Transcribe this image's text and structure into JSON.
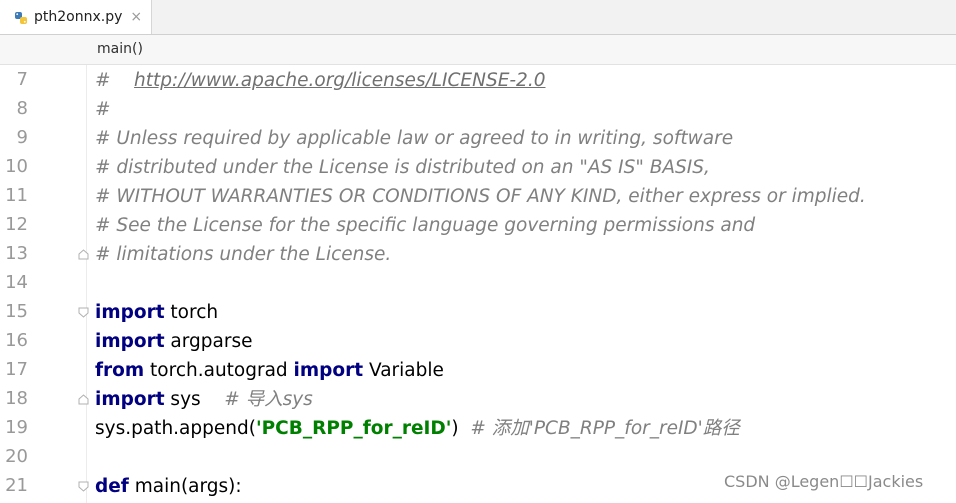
{
  "tab": {
    "filename": "pth2onnx.py",
    "close": "×",
    "icon": "python-file-icon"
  },
  "breadcrumb": {
    "label": "main()"
  },
  "colors": {
    "keyword": "#000080",
    "string": "#008000",
    "comment": "#808080",
    "line_number": "#999999"
  },
  "lines": [
    {
      "num": "7",
      "segments": [
        {
          "t": "# ",
          "c": "cm"
        },
        {
          "t": "   ",
          "c": "cm"
        },
        {
          "t": "http://www.apache.org/licenses/LICENSE-2.0",
          "c": "link"
        }
      ]
    },
    {
      "num": "8",
      "segments": [
        {
          "t": "#",
          "c": "cm"
        }
      ]
    },
    {
      "num": "9",
      "segments": [
        {
          "t": "# Unless required by applicable law or agreed to in writing, software",
          "c": "cm"
        }
      ]
    },
    {
      "num": "10",
      "segments": [
        {
          "t": "# distributed under the License is distributed on an \"AS IS\" BASIS,",
          "c": "cm"
        }
      ]
    },
    {
      "num": "11",
      "segments": [
        {
          "t": "# WITHOUT WARRANTIES OR CONDITIONS OF ANY KIND, either express or implied.",
          "c": "cm"
        }
      ]
    },
    {
      "num": "12",
      "segments": [
        {
          "t": "# See the License for the specific language governing permissions and",
          "c": "cm"
        }
      ]
    },
    {
      "num": "13",
      "segments": [
        {
          "t": "# limitations under the License.",
          "c": "cm"
        }
      ]
    },
    {
      "num": "14",
      "segments": []
    },
    {
      "num": "15",
      "segments": [
        {
          "t": "import",
          "c": "kw"
        },
        {
          "t": " torch",
          "c": ""
        }
      ]
    },
    {
      "num": "16",
      "segments": [
        {
          "t": "import",
          "c": "kw"
        },
        {
          "t": " argparse",
          "c": ""
        }
      ]
    },
    {
      "num": "17",
      "segments": [
        {
          "t": "from",
          "c": "kw"
        },
        {
          "t": " torch.autograd ",
          "c": ""
        },
        {
          "t": "import",
          "c": "kw"
        },
        {
          "t": " Variable",
          "c": ""
        }
      ]
    },
    {
      "num": "18",
      "segments": [
        {
          "t": "import",
          "c": "kw"
        },
        {
          "t": " sys    ",
          "c": ""
        },
        {
          "t": "# 导入sys",
          "c": "cm"
        }
      ]
    },
    {
      "num": "19",
      "segments": [
        {
          "t": "sys.path.append(",
          "c": ""
        },
        {
          "t": "'PCB_RPP_for_reID'",
          "c": "str"
        },
        {
          "t": ")  ",
          "c": ""
        },
        {
          "t": "# 添加'PCB_RPP_for_reID'路径",
          "c": "cm"
        }
      ]
    },
    {
      "num": "20",
      "segments": []
    },
    {
      "num": "21",
      "segments": [
        {
          "t": "def",
          "c": "kw"
        },
        {
          "t": " main(args):",
          "c": ""
        }
      ]
    }
  ],
  "watermark": "CSDN @Legen☐☐Jackies"
}
